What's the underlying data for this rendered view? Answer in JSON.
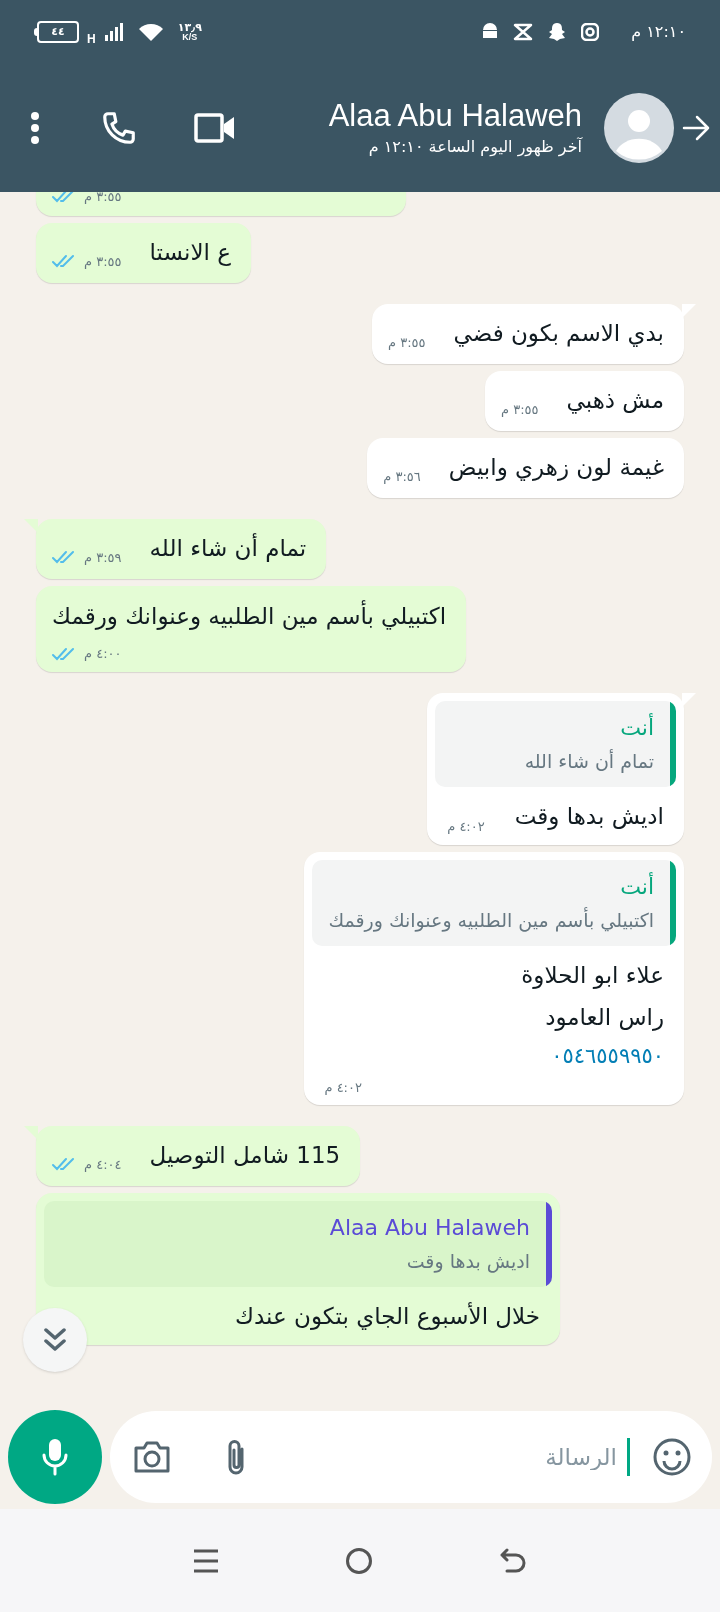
{
  "status_bar": {
    "battery": "٤٤",
    "network": "H",
    "speed": "١٣٫٩",
    "speed_unit": "K/S",
    "time": "١٢:١٠ م"
  },
  "header": {
    "name": "Alaa Abu Halaweh",
    "last_seen": "آخر ظهور اليوم الساعة ١٢:١٠ م"
  },
  "messages": [
    {
      "kind": "text",
      "outgoing": true,
      "tail": false,
      "time": "٣:٥٥ م",
      "read": true
    },
    {
      "kind": "text",
      "outgoing": true,
      "tail": false,
      "text": "ع الانستا",
      "time": "٣:٥٥ م",
      "read": true
    },
    {
      "kind": "text",
      "outgoing": false,
      "tail": true,
      "text": "بدي الاسم بكون فضي",
      "time": "٣:٥٥ م"
    },
    {
      "kind": "text",
      "outgoing": false,
      "tail": false,
      "text": "مش ذهبي",
      "time": "٣:٥٥ م"
    },
    {
      "kind": "text",
      "outgoing": false,
      "tail": false,
      "text": "غيمة لون زهري وابيض",
      "time": "٣:٥٦ م"
    },
    {
      "kind": "text",
      "outgoing": true,
      "tail": true,
      "text": "تمام أن شاء الله",
      "time": "٣:٥٩ م",
      "read": true
    },
    {
      "kind": "block",
      "outgoing": true,
      "tail": false,
      "lines": [
        "اكتبيلي بأسم مين الطلبيه وعنوانك ورقمك"
      ],
      "time": "٤:٠٠ م",
      "read": true
    },
    {
      "kind": "reply",
      "outgoing": false,
      "tail": true,
      "quote": {
        "author": "أنت",
        "text": "تمام أن شاء الله",
        "color": "#06a77d"
      },
      "lines": [
        "اديش بدها وقت"
      ],
      "time": "٤:٠٢ م"
    },
    {
      "kind": "reply",
      "outgoing": false,
      "tail": false,
      "quote": {
        "author": "أنت",
        "text": "اكتبيلي بأسم مين الطلبيه وعنوانك ورقمك",
        "color": "#06a77d"
      },
      "lines": [
        "علاء ابو الحلاوة",
        "راس العامود"
      ],
      "phone": "٠٥٤٦٥٥٩٩٥٠",
      "time": "٤:٠٢ م"
    },
    {
      "kind": "text",
      "outgoing": true,
      "tail": true,
      "text": "115 شامل التوصيل",
      "time": "٤:٠٤ م",
      "read": true
    },
    {
      "kind": "reply",
      "outgoing": true,
      "tail": false,
      "quote": {
        "author": "Alaa Abu Halaweh",
        "text": "اديش بدها وقت",
        "color": "#5b4bd6"
      },
      "lines": [
        "خلال الأسبوع الجاي بتكون عندك"
      ]
    }
  ],
  "composer": {
    "placeholder": "الرسالة"
  }
}
